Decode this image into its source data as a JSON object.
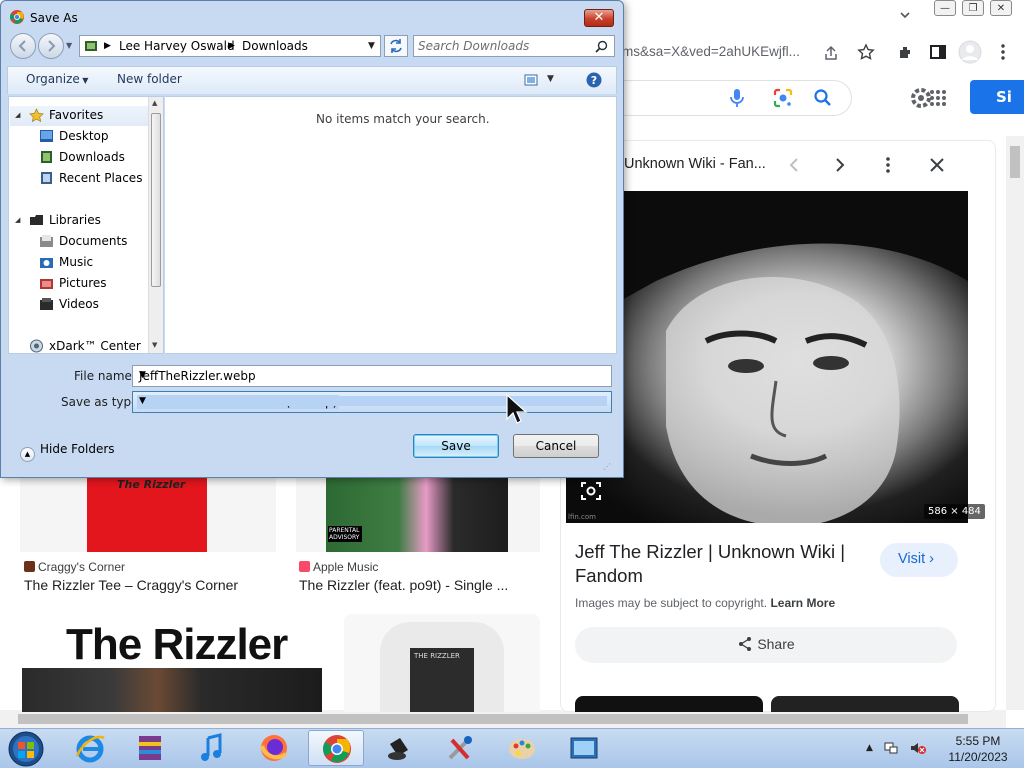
{
  "browser": {
    "url_fragment": "ms&sa=X&ved=2ahUKEwjfl...",
    "signin_partial": "Si",
    "win_minimize": "—",
    "win_restore": "❐",
    "win_close": "✕"
  },
  "panel": {
    "source_title": "Unknown Wiki - Fan...",
    "image_size": "586 × 484",
    "image_credit": "lfin.com",
    "heading": "Jeff The Rizzler | Unknown Wiki | Fandom",
    "visit_label": "Visit",
    "copyright_text": "Images may be subject to copyright.",
    "learn_more": "Learn More",
    "share_label": "Share"
  },
  "results": [
    {
      "tee_text": "The Rizzler",
      "source": "Craggy's Corner",
      "title": "The Rizzler Tee – Craggy's Corner"
    },
    {
      "advisory": "PARENTAL ADVISORY",
      "source": "Apple Music",
      "title": "The Rizzler (feat. po9t) - Single ..."
    },
    {
      "big_text": "The Rizzler"
    },
    {
      "shirt_text": "THE RIZZLER"
    }
  ],
  "dialog": {
    "title": "Save As",
    "close": "✕",
    "path": [
      "Lee Harvey Oswald",
      "Downloads"
    ],
    "search_placeholder": "Search Downloads",
    "organize": "Organize",
    "new_folder": "New folder",
    "nav": {
      "favorites_header": "Favorites",
      "favorites": [
        "Desktop",
        "Downloads",
        "Recent Places"
      ],
      "libraries_header": "Libraries",
      "libraries": [
        "Documents",
        "Music",
        "Pictures",
        "Videos"
      ],
      "extra": "xDark™ Center"
    },
    "empty_message": "No items match your search.",
    "file_name_label": "File name:",
    "file_name_value": "JeffTheRizzler.webp",
    "save_type_label": "Save as type:",
    "save_type_value": "Firefox HTML Document (*.webp)",
    "hide_folders": "Hide Folders",
    "save_button": "Save",
    "cancel_button": "Cancel"
  },
  "taskbar": {
    "time": "5:55 PM",
    "date": "11/20/2023",
    "apps": [
      "start-orb",
      "internet-explorer",
      "archive-app",
      "itunes",
      "firefox",
      "chrome",
      "paint-bucket",
      "tools-app",
      "paint-palette",
      "screenshot-app"
    ]
  },
  "colors": {
    "accent": "#1a73e8",
    "dialog_frame": "#c7daf2",
    "taskbar": "#b6cfee"
  }
}
